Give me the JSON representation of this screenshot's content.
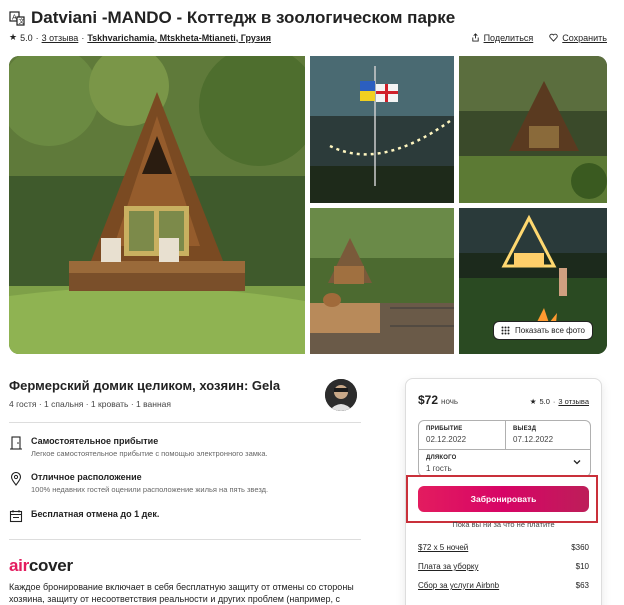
{
  "listing": {
    "title": "Datviani -MANDO - Коттедж в зоологическом парке",
    "rating": "5.0",
    "reviews": "3 отзыва",
    "location": "Tskhvarichamia, Mtskheta-Mtianeti, Грузия",
    "share": "Поделиться",
    "save": "Сохранить"
  },
  "gallery": {
    "show_all": "Показать все фото"
  },
  "host": {
    "title": "Фермерский домик целиком, хозяин: Gela",
    "details": "4 гостя · 1 спальня · 1 кровать · 1 ванная"
  },
  "features": [
    {
      "title": "Самостоятельное прибытие",
      "subtitle": "Легкое самостоятельное прибытие с помощью электронного замка.",
      "icon": "door-icon"
    },
    {
      "title": "Отличное расположение",
      "subtitle": "100% недавних гостей оценили расположение жилья на пять звезд.",
      "icon": "location-pin-icon"
    },
    {
      "title": "Бесплатная отмена до 1 дек.",
      "subtitle": "",
      "icon": "calendar-icon"
    }
  ],
  "aircover": {
    "logo_air": "air",
    "logo_cover": "cover",
    "text": "Каждое бронирование включает в себя бесплатную защиту от отмены со стороны хозяина, защиту от несоответствия реальности и других проблем (например, с"
  },
  "booking": {
    "price": "$72",
    "per_night": "ночь",
    "rating": "5.0",
    "reviews": "3 отзыва",
    "checkin_label": "ПРИБЫТИЕ",
    "checkin": "02.12.2022",
    "checkout_label": "ВЫЕЗД",
    "checkout": "07.12.2022",
    "guests_label": "ДЛЯКОГО",
    "guests": "1 гость",
    "reserve": "Забронировать",
    "no_charge": "Пока вы ни за что не платите",
    "lines": [
      {
        "label": "$72 x 5 ночей",
        "amount": "$360"
      },
      {
        "label": "Плата за уборку",
        "amount": "$10"
      },
      {
        "label": "Сбор за услуги Airbnb",
        "amount": "$63"
      }
    ]
  },
  "colors": {
    "brand": "#e31c5f",
    "highlight": "#c9303a"
  }
}
